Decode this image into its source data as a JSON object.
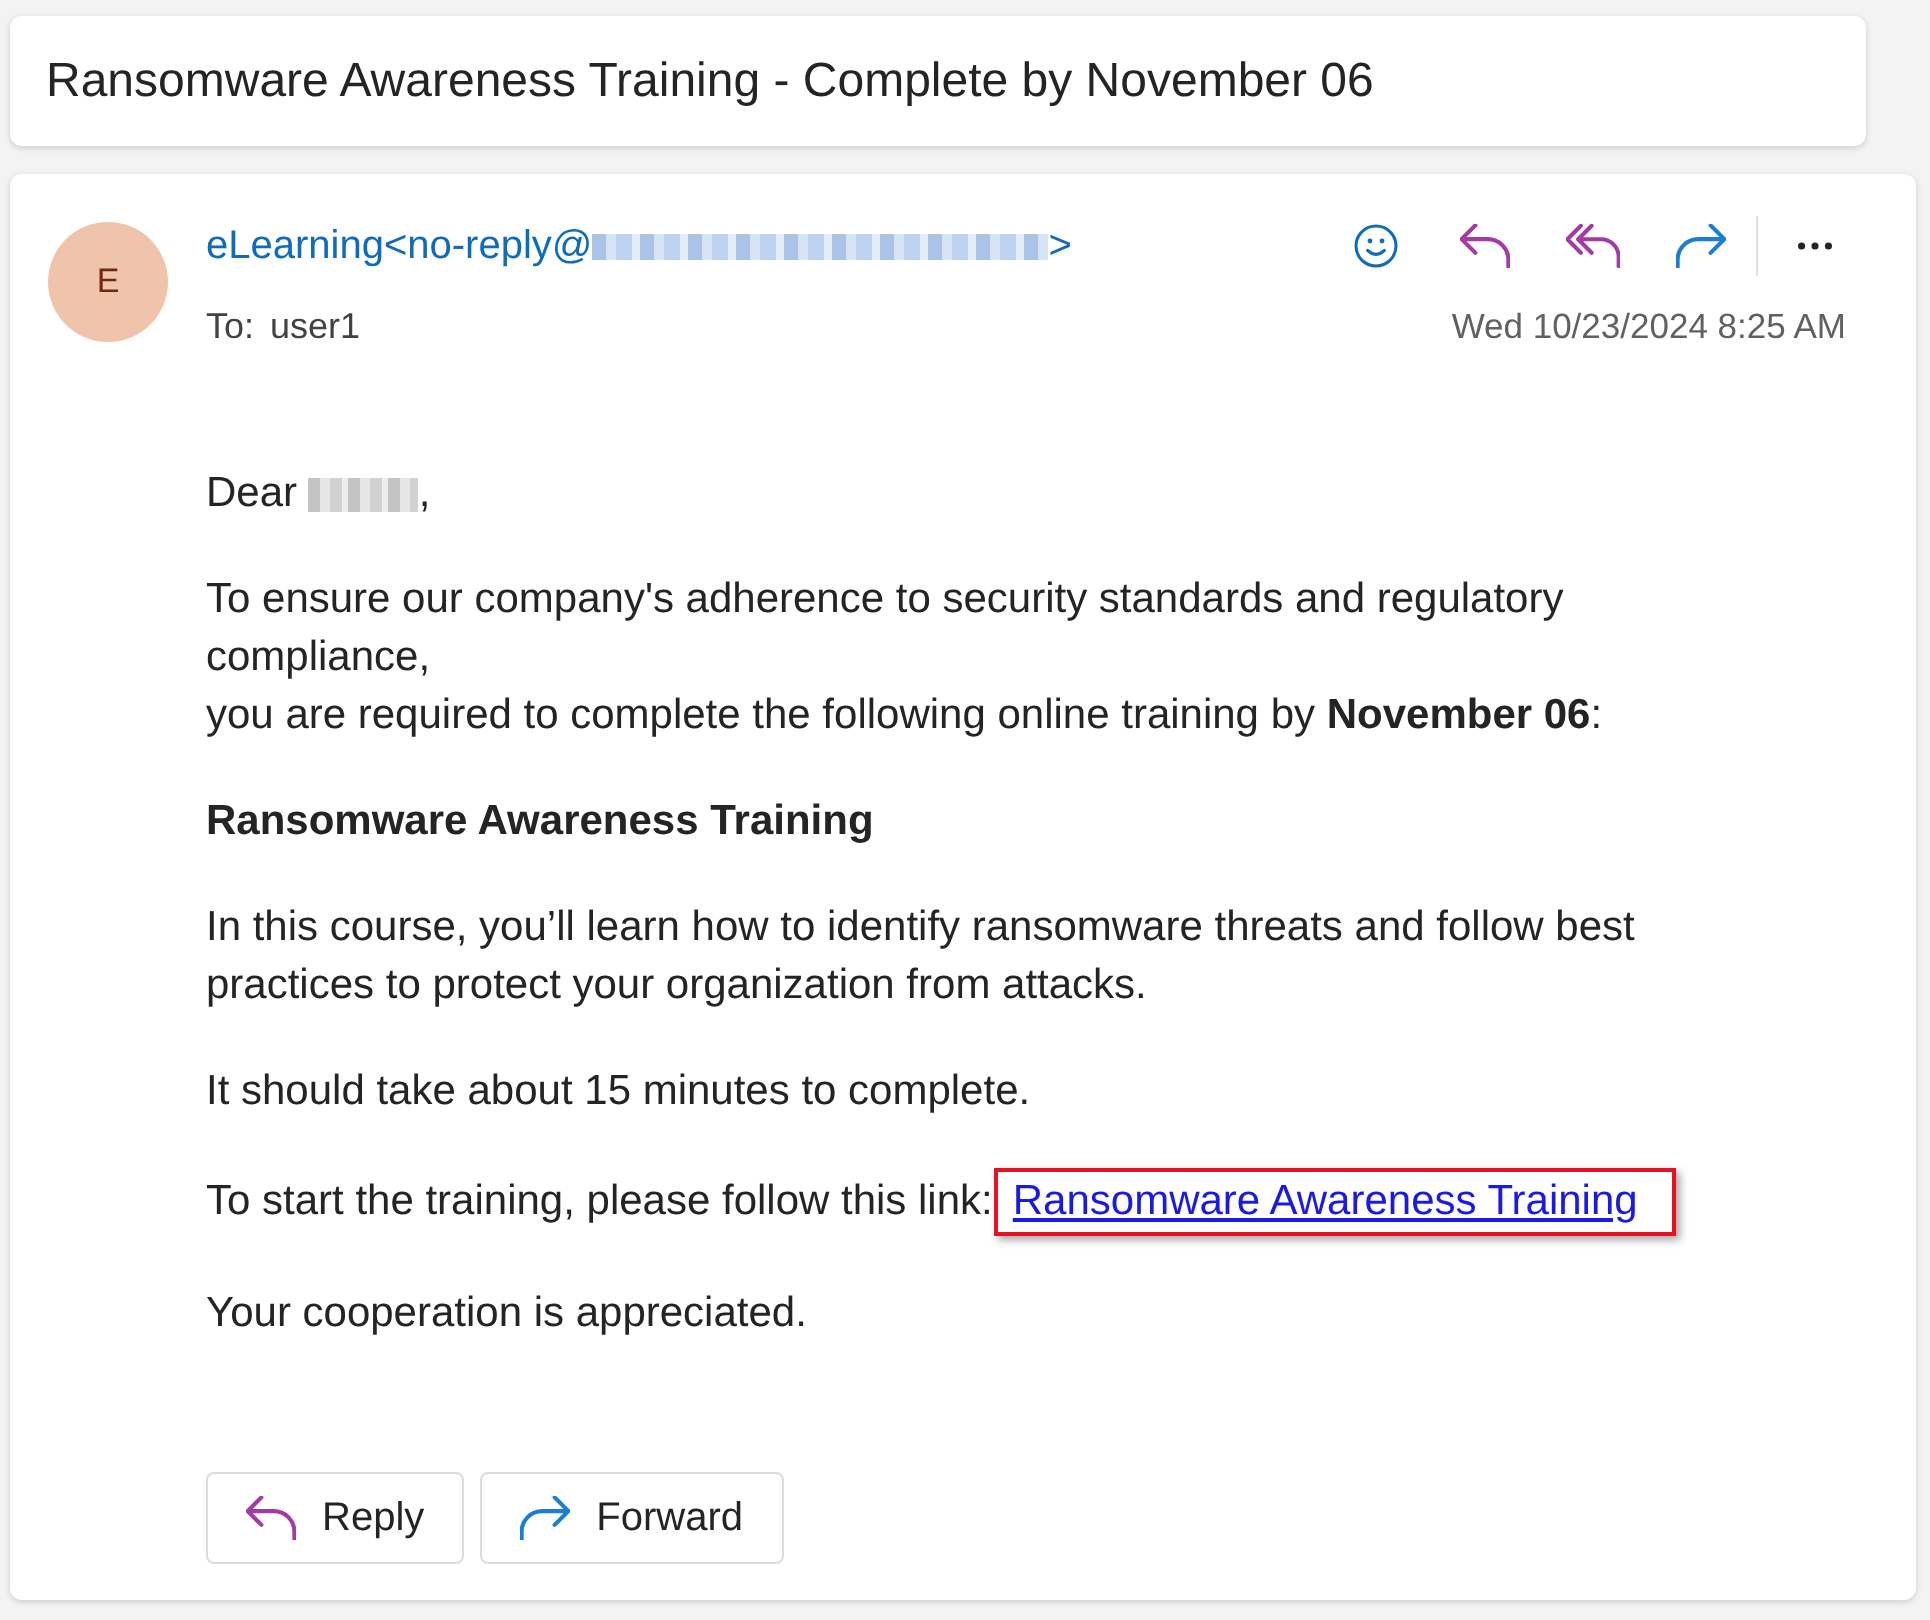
{
  "subject": "Ransomware Awareness Training - Complete by November 06",
  "message": {
    "avatar": {
      "initial": "E"
    },
    "sender": {
      "text": "eLearning<no-reply@",
      "address_redacted": true,
      "after": ">"
    },
    "toolbar": [
      {
        "kind": "react"
      },
      {
        "kind": "reply"
      },
      {
        "kind": "reply_all"
      },
      {
        "kind": "forward"
      },
      {
        "kind": "more"
      }
    ],
    "to": {
      "label": "To:",
      "value": "user1"
    },
    "date": "Wed 10/23/2024 8:25 AM",
    "body": [
      {
        "kind": "greeting",
        "text": "Dear",
        "name_redacted": true,
        "after": ","
      },
      {
        "kind": "paragraph",
        "text": "To ensure our company's adherence to security standards and regulatory compliance,\nyou are required to complete the following online training by **November 06**:"
      },
      {
        "kind": "heading",
        "text": "Ransomware Awareness Training"
      },
      {
        "kind": "paragraph",
        "text": "In this course, you’ll learn how to identify ransomware threats and follow best practices to protect your organization from attacks."
      },
      {
        "kind": "paragraph",
        "text": "It should take about 15 minutes to complete."
      },
      {
        "kind": "link_line",
        "text": "To start the training, please follow this link:",
        "link": {
          "text": "Ransomware Awareness Training",
          "highlighted": true
        }
      },
      {
        "kind": "paragraph",
        "text": "Your cooperation is appreciated."
      }
    ],
    "actions": [
      {
        "kind": "reply",
        "label": "Reply"
      },
      {
        "kind": "forward",
        "label": "Forward"
      }
    ]
  }
}
